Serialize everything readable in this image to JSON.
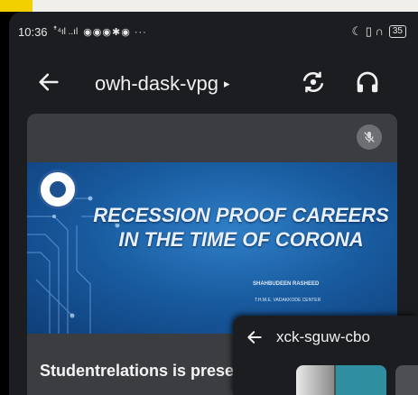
{
  "status_bar": {
    "time": "10:36",
    "indicators": "ꜛ⁴ıl ..ıl",
    "app_icons": "◉◉◉✱◉ ···",
    "right_icons": "☾ ▯ ∩",
    "battery": "35"
  },
  "header": {
    "meeting_code": "owh-dask-vpg",
    "expand_glyph": "▸"
  },
  "slide": {
    "title_line1": "RECESSION PROOF CAREERS",
    "title_line2": "IN THE TIME OF CORONA",
    "presenter": "SHAHBUDEEN RASHEED",
    "center": "T.H.M.E. VADAKKODE CENTER"
  },
  "caption": "Studentrelations is prese",
  "pip": {
    "meeting_code": "xck-sguw-cbo"
  },
  "colors": {
    "accent_yellow": "#f2d000",
    "slide_blue": "#185a9e",
    "card_bg": "#3b3d40",
    "app_bg": "#1c1d20"
  }
}
